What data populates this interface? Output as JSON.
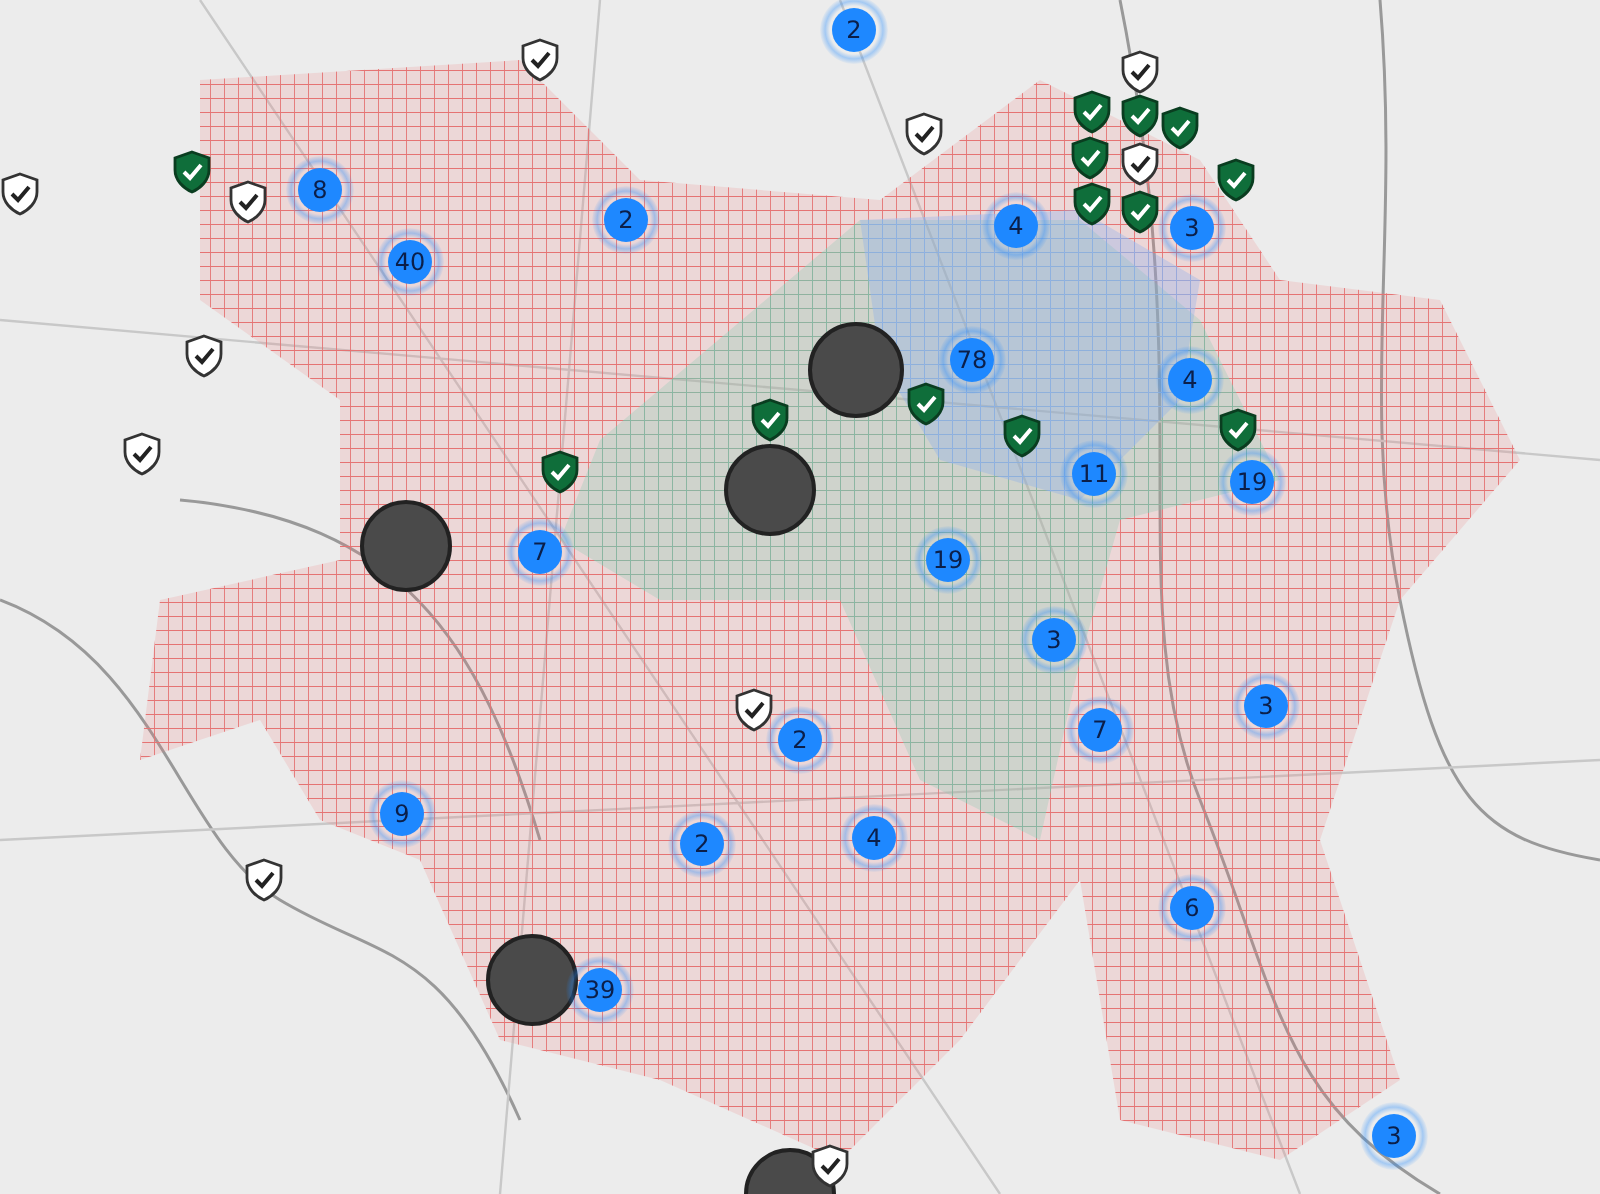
{
  "map": {
    "clusters": [
      {
        "count": "2"
      },
      {
        "count": "8"
      },
      {
        "count": "2"
      },
      {
        "count": "40"
      },
      {
        "count": "4"
      },
      {
        "count": "3"
      },
      {
        "count": "78"
      },
      {
        "count": "4"
      },
      {
        "count": "11"
      },
      {
        "count": "19"
      },
      {
        "count": "7"
      },
      {
        "count": "19"
      },
      {
        "count": "3"
      },
      {
        "count": "3"
      },
      {
        "count": "7"
      },
      {
        "count": "2"
      },
      {
        "count": "9"
      },
      {
        "count": "2"
      },
      {
        "count": "4"
      },
      {
        "count": "6"
      },
      {
        "count": "39"
      },
      {
        "count": "3"
      }
    ],
    "markers": [
      {
        "kind": "outline"
      },
      {
        "kind": "outline"
      },
      {
        "kind": "outline"
      },
      {
        "kind": "outline"
      },
      {
        "kind": "outline"
      },
      {
        "kind": "outline"
      },
      {
        "kind": "outline"
      },
      {
        "kind": "outline"
      },
      {
        "kind": "outline"
      },
      {
        "kind": "outline"
      },
      {
        "kind": "outline"
      },
      {
        "kind": "filled"
      },
      {
        "kind": "filled"
      },
      {
        "kind": "filled"
      },
      {
        "kind": "filled"
      },
      {
        "kind": "filled"
      },
      {
        "kind": "filled"
      },
      {
        "kind": "filled"
      },
      {
        "kind": "filled"
      },
      {
        "kind": "filled"
      },
      {
        "kind": "filled"
      },
      {
        "kind": "filled"
      },
      {
        "kind": "filled"
      },
      {
        "kind": "filled"
      }
    ]
  }
}
